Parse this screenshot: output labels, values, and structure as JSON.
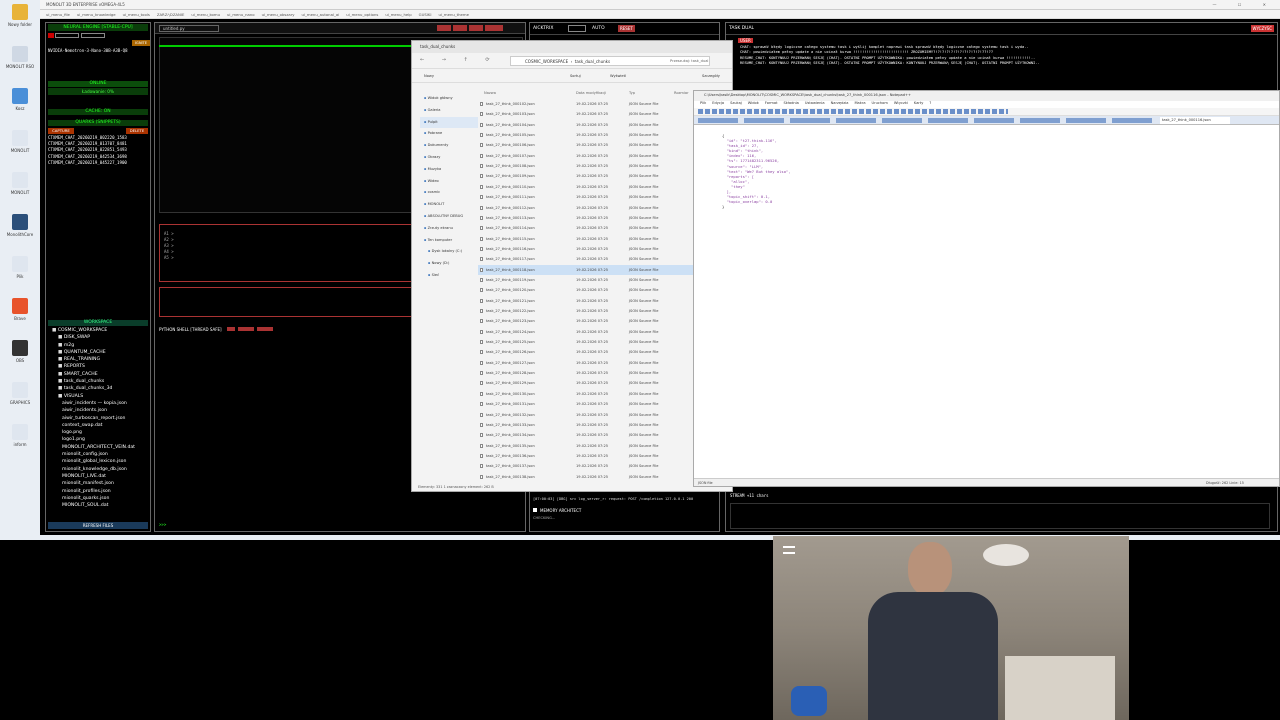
{
  "desktop": {
    "icons": [
      {
        "label": "Nowy folder",
        "color": "#e8b339"
      },
      {
        "label": "MONOLIT RSO",
        "color": "#cfd8e4"
      },
      {
        "label": "Kosz",
        "color": "#4a8fd8"
      },
      {
        "label": "MONOLIT",
        "color": "#dfe6ef"
      },
      {
        "label": "MONOLIT",
        "color": "#dfe6ef"
      },
      {
        "label": "MonolithCore",
        "color": "#2b4f7a"
      },
      {
        "label": "Plik",
        "color": "#dfe6ef"
      },
      {
        "label": "Brave",
        "color": "#e8532b"
      },
      {
        "label": "OBS",
        "color": "#333333"
      },
      {
        "label": "GRAPHICS",
        "color": "#dfe6ef"
      },
      {
        "label": "inform",
        "color": "#dfe6ef"
      }
    ]
  },
  "app": {
    "title": "MONOLIT 3D ENTERPRISE vOMEGA-4L5",
    "window_controls": "—  ☐  ✕",
    "menu": [
      "ui_menu_file",
      "ui_menu_knowledge",
      "ui_menu_tools",
      "ZARZĄDZANIE",
      "ui_menu_komu",
      "ui_menu_nano",
      "ui_menu_obszary",
      "ui_menu_autonal_ai",
      "ui_menu_options",
      "ui_menu_help",
      "GUSIKI",
      "ui_menu_theme"
    ]
  },
  "left": {
    "engine_title": "NEURAL ENGINE [STABLE-CPU]",
    "model_name": "NVIDIA-Nemotron-3-Nano-30B-A3B-Q8",
    "ignite": "IGNITE",
    "status": "ONLINE",
    "loading": "Ładowanie: 0%",
    "cache": "CACHE: ON",
    "quarks_title": "QUARKS (SNIPPETS)",
    "capture": "CAPTURE",
    "delete": "DELETE",
    "quarks": [
      "CTXMEM_CHAT_20260219_002220_1583",
      "CTXMEM_CHAT_20260219_013707_8481",
      "CTXMEM_CHAT_20260219_022851_5493",
      "CTXMEM_CHAT_20260219_042534_3698",
      "CTXMEM_CHAT_20260219_045227_1900"
    ],
    "workspace_title": "WORKSPACE",
    "workspace": [
      "COSMIC_WORKSPACE",
      "DISK_SWAP",
      "m2g",
      "QUANTUM_CACHE",
      "REAL_TRAINING",
      "REPORTS",
      "SMART_CACHE",
      "task_dual_chunks",
      "task_dual_chunks_3d",
      "VISUALS",
      "aiwir_incidents — kopia.json",
      "aiwir_incidents.json",
      "aiwir_turboscan_report.json",
      "context_swap.dat",
      "logo.png",
      "logo1.png",
      "MIONOLIT_ARCHITECT_VEIN.dat",
      "mionolit_config.json",
      "mionolit_global_lexicon.json",
      "mionolit_knowledge_db.json",
      "MIONOLIT_LIVE.dat",
      "mionolit_manifest.json",
      "mionolit_profiles.json",
      "mionolit_quarks.json",
      "MIONOLIT_SOUL.dat"
    ],
    "refresh": "REFRESH FILES"
  },
  "editor": {
    "tab": "untitled.py",
    "prompt_lines": [
      "A1 >",
      "A2 >",
      "A3 >",
      "A4 >",
      "A5 >"
    ],
    "shell_title": "PYTHON SHELL [THREAD SAFE]",
    "shell_prompt": ">>>"
  },
  "chat": {
    "aicktrix": "AICKTRIX",
    "auto": "AUTO",
    "reset": "RESET",
    "task_dual": "TASK DUAL",
    "wyczysc": "WYCZYŚĆ",
    "user": "USER",
    "lines": [
      "CHAT: sprawdź błędy logiczne całego systemu task i wyślij komplet naprawi task sprawdź błędy logiczne całego systemu task i wyda..",
      "CHAT: powiedziałem pełny update a nie ucinał kurwa !!!!!!!!!!!!!!!!!!!!!!!!! ZROZUMIEMY?!?!?!?!?!?!?!?!?!?!?!??!??",
      "RESUME_CHAT: KONTYNUUJ PRZERWANĄ SESJĘ (CHAT). OSTATNI PROMPT UŻYTKOWNIKA: powiedziałem pełny update a nie ucinał kurwa !!!!!!!!!!!..",
      "RESUME_CHAT: KONTYNUUJ PRZERWANĄ SESJĘ (CHAT). OSTATNI PROMPT UŻYTKOWNIKA: KONTYNUUJ PRZERWANĄ SESJĘ (CHAT). OSTATNI PROMPT UŻYTKOWNI.."
    ],
    "log_line": "[07:00:03] [DBG] src  log_server_r: request: POST /completion 127.0.0.1 200",
    "memory": "MEMORY ARCHITECT",
    "checking": "CHECKING...",
    "stream": "STREAM +11 chars"
  },
  "explorer": {
    "tab": "task_dual_chunks",
    "path": [
      "COSMIC_WORKSPACE",
      "task_dual_chunks"
    ],
    "search": "Przeszukaj: task_dual",
    "new": "Nowy",
    "sort": "Sortuj",
    "view": "Wyświetl",
    "details": "Szczegóły",
    "headers": [
      "Nazwa",
      "Data modyfikacji",
      "Typ",
      "Rozmiar"
    ],
    "nav": [
      "Widok główny",
      "Galeria",
      "Pulpit",
      "Pobrane",
      "Dokumenty",
      "Obrazy",
      "Muzyka",
      "Wideo",
      "cosmic",
      "MONOLIT",
      "ABSOLUTNY DEBUG",
      "Zrzuty ekranu",
      "Ten komputer",
      "Dysk lokalny (C:)",
      "Nowy (D:)",
      "Sieć"
    ],
    "date": "19.02.2026 07:25",
    "type": "JSON Source File",
    "files": [
      "task_27_think_000102.json",
      "task_27_think_000103.json",
      "task_27_think_000104.json",
      "task_27_think_000105.json",
      "task_27_think_000106.json",
      "task_27_think_000107.json",
      "task_27_think_000108.json",
      "task_27_think_000109.json",
      "task_27_think_000110.json",
      "task_27_think_000111.json",
      "task_27_think_000112.json",
      "task_27_think_000113.json",
      "task_27_think_000114.json",
      "task_27_think_000115.json",
      "task_27_think_000116.json",
      "task_27_think_000117.json",
      "task_27_think_000118.json",
      "task_27_think_000119.json",
      "task_27_think_000120.json",
      "task_27_think_000121.json",
      "task_27_think_000122.json",
      "task_27_think_000123.json",
      "task_27_think_000124.json",
      "task_27_think_000125.json",
      "task_27_think_000126.json",
      "task_27_think_000127.json",
      "task_27_think_000128.json",
      "task_27_think_000129.json",
      "task_27_think_000130.json",
      "task_27_think_000131.json",
      "task_27_think_000132.json",
      "task_27_think_000133.json",
      "task_27_think_000134.json",
      "task_27_think_000135.json",
      "task_27_think_000136.json",
      "task_27_think_000137.json",
      "task_27_think_000138.json"
    ],
    "status": "Elementy: 331   1 zaznaczony element: 262 B"
  },
  "notepad": {
    "title": "C:\\Users\\kasik\\Desktop\\MONOLIT\\COSMIC_WORKSPACE\\task_dual_chunks\\task_27_think_000116.json - Notepad++",
    "menu": [
      "Plik",
      "Edycja",
      "Szukaj",
      "Widok",
      "Format",
      "Składnia",
      "Ustawienia",
      "Narzędzia",
      "Makra",
      "Uruchom",
      "Wtyczki",
      "Karty",
      "?"
    ],
    "active_tab": "task_27_think_000116.json",
    "code": [
      "{",
      "  \"id\": \"t27-think-116\",",
      "  \"task_id\": 27,",
      "  \"kind\": \"think\",",
      "  \"index\": 116,",
      "  \"ts\": 1771482311.96526,",
      "  \"source\": \"LLM\",",
      "  \"text\": \"We? But they also\",",
      "  \"reports\": [",
      "    \"alloc\",",
      "    \"they\"",
      "  ],",
      "  \"topic_shift\": 0.1,",
      "  \"topic_overlap\": 0.0",
      "}"
    ],
    "status_left": "JSON file",
    "status_right": "Długość: 262   Linie: 15"
  }
}
